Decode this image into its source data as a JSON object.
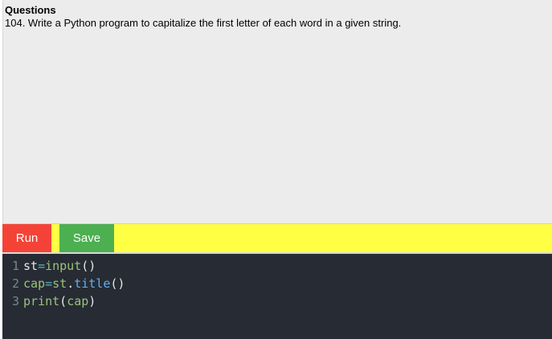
{
  "questions": {
    "heading": "Questions",
    "text": "104. Write a Python program to capitalize the first letter of each word in a given string."
  },
  "toolbar": {
    "run_label": "Run",
    "save_label": "Save"
  },
  "editor": {
    "lines": [
      {
        "number": "1",
        "tokens": [
          {
            "text": "st",
            "kind": "var"
          },
          {
            "text": "=",
            "kind": "op"
          },
          {
            "text": "input",
            "kind": "fn"
          },
          {
            "text": "()",
            "kind": "var"
          }
        ]
      },
      {
        "number": "2",
        "tokens": [
          {
            "text": "cap",
            "kind": "fn"
          },
          {
            "text": "=",
            "kind": "op"
          },
          {
            "text": "st",
            "kind": "fn"
          },
          {
            "text": ".",
            "kind": "var"
          },
          {
            "text": "title",
            "kind": "attr"
          },
          {
            "text": "()",
            "kind": "var"
          }
        ]
      },
      {
        "number": "3",
        "tokens": [
          {
            "text": "print",
            "kind": "fn"
          },
          {
            "text": "(",
            "kind": "var"
          },
          {
            "text": "cap",
            "kind": "fn"
          },
          {
            "text": ")",
            "kind": "var"
          }
        ]
      }
    ]
  },
  "colors": {
    "run_button": "#f44336",
    "save_button": "#4caf50",
    "toolbar": "#ffff44",
    "editor_background": "#272b34",
    "question_panel": "#ececec"
  }
}
